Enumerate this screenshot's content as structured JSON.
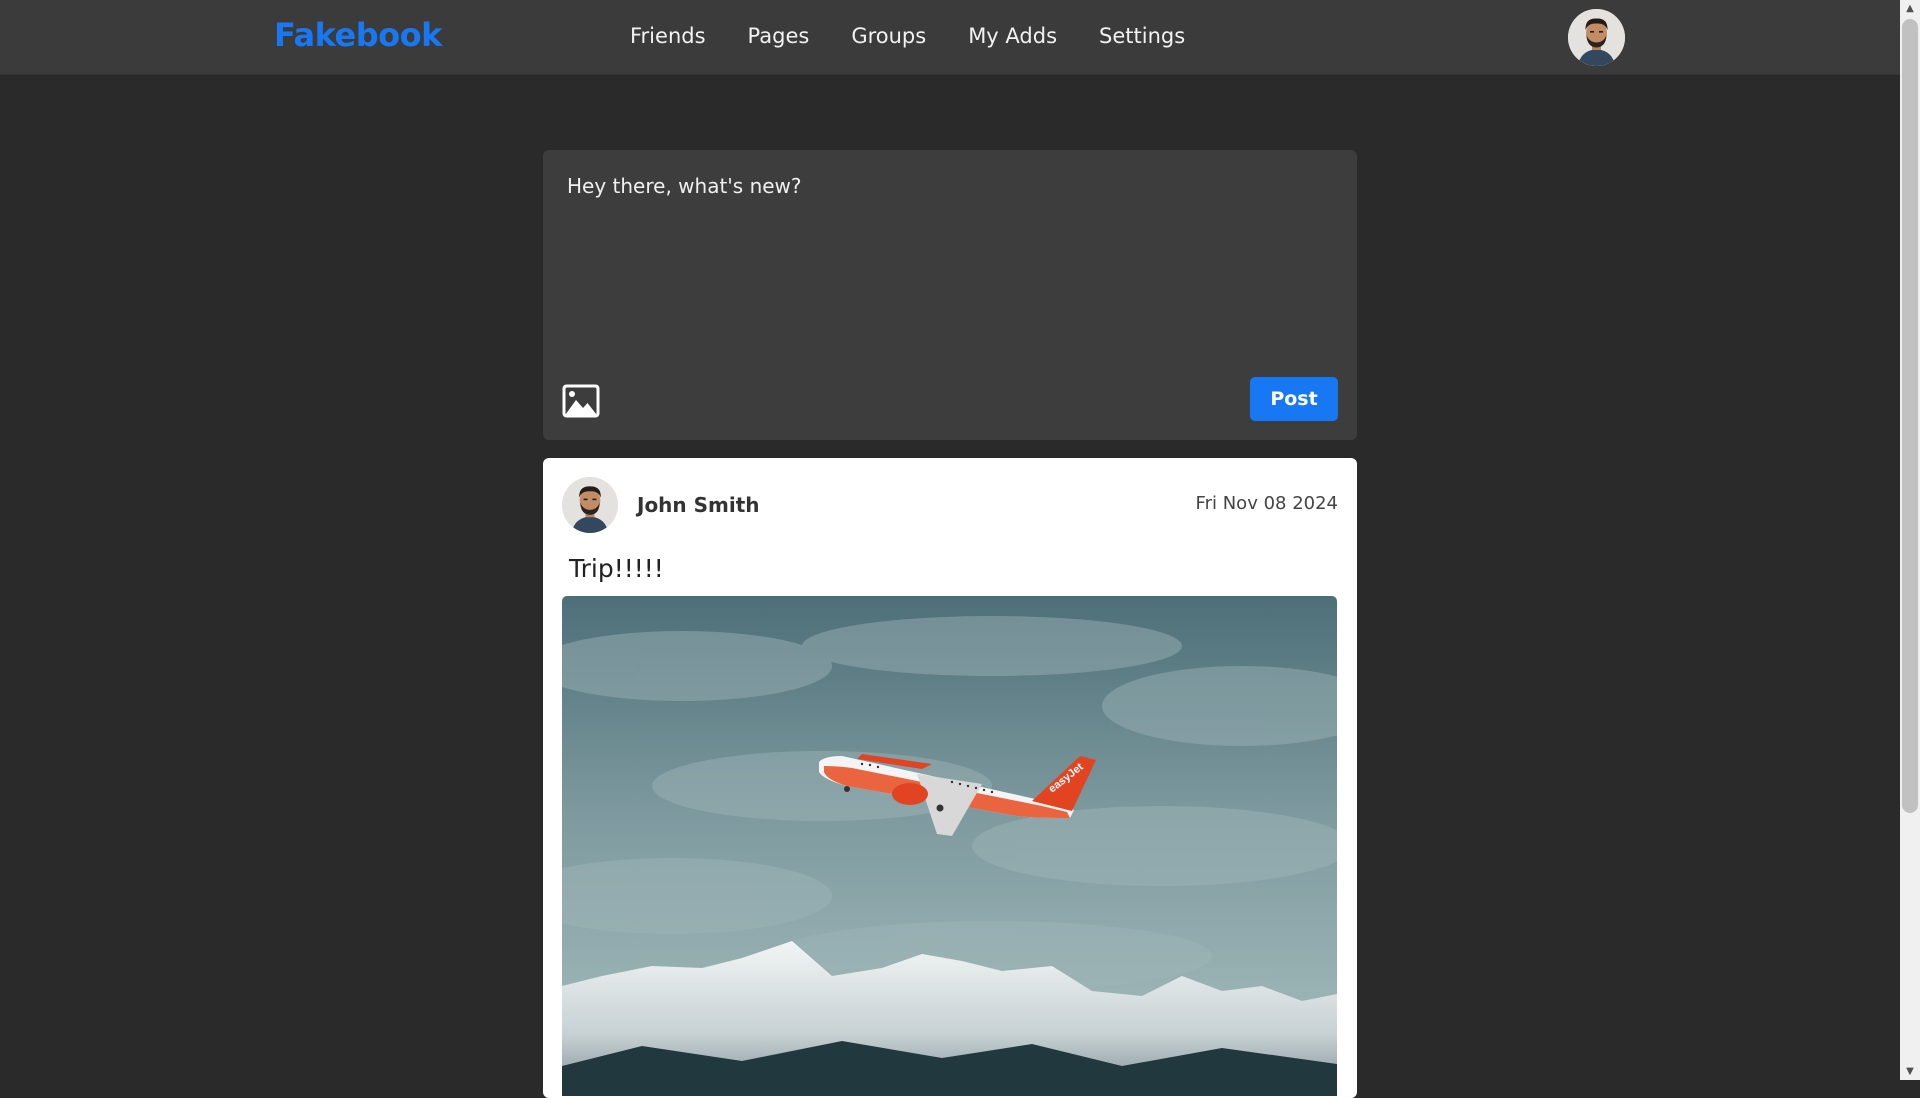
{
  "navbar": {
    "logo": "Fakebook",
    "links": [
      "Friends",
      "Pages",
      "Groups",
      "My Adds",
      "Settings"
    ],
    "avatar_icon": "user-avatar-icon"
  },
  "composer": {
    "placeholder": "Hey there, what's new?",
    "image_icon": "image-icon",
    "post_label": "Post"
  },
  "post": {
    "author": "John Smith",
    "date": "Fri Nov 08 2024",
    "text": "Trip!!!!!",
    "airline_livery": "easyJet",
    "image_icon": "airplane-photo"
  },
  "colors": {
    "brand": "#1877f2",
    "page_bg": "#2a2a2a",
    "navbar_bg": "#3b3b3b",
    "composer_bg": "#3d3d3d",
    "card_bg": "#ffffff"
  }
}
